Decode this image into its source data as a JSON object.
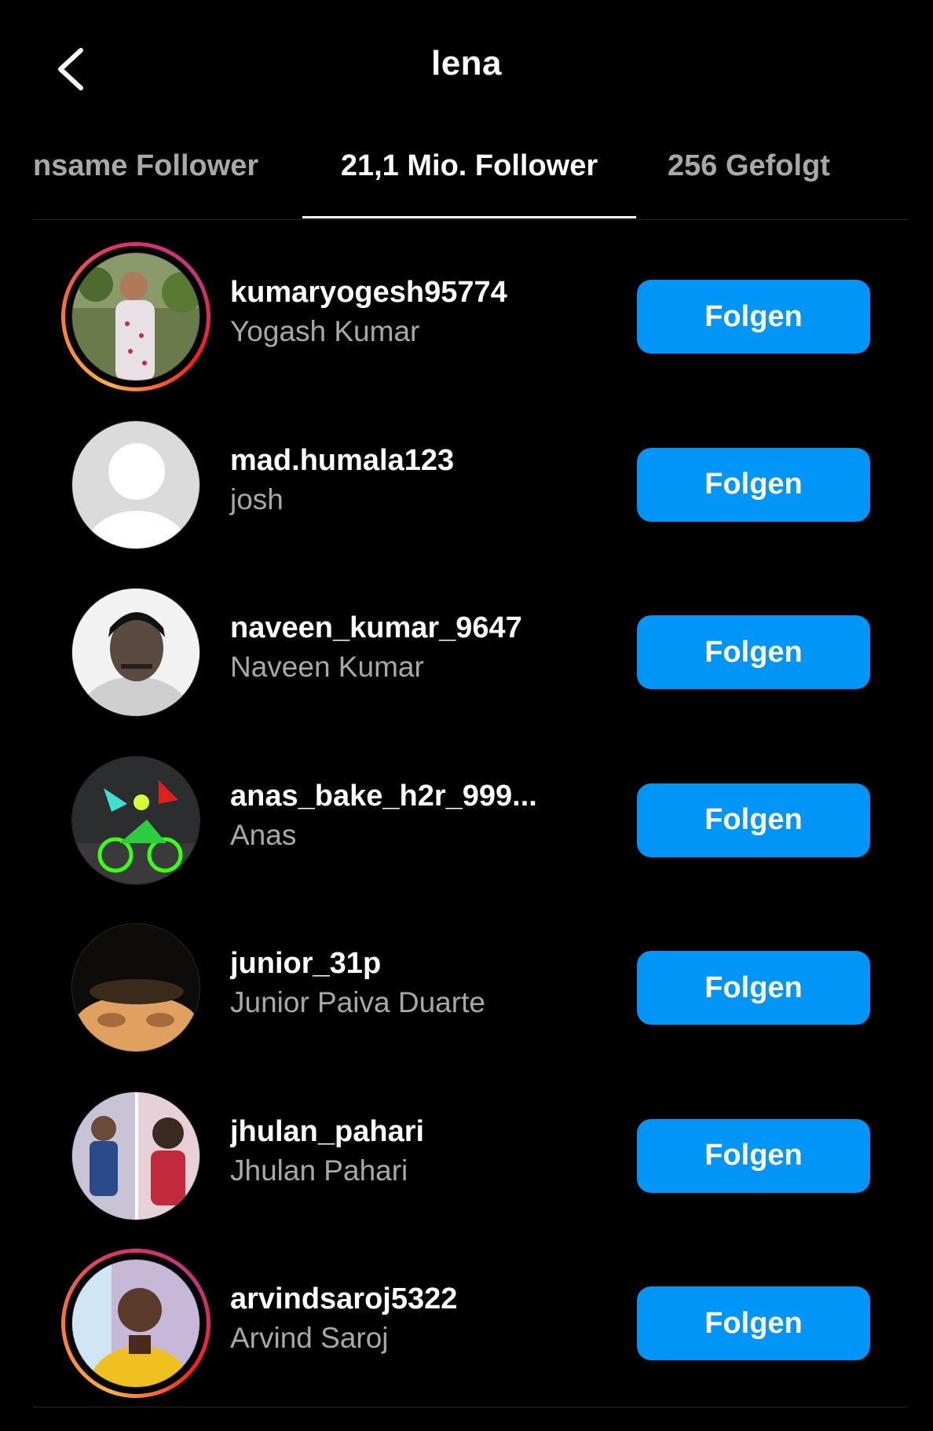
{
  "header": {
    "title": "lena",
    "back_icon": "chevron-left-icon"
  },
  "tabs": [
    {
      "label": "nsame Follower",
      "active": false
    },
    {
      "label": "21,1 Mio. Follower",
      "active": true
    },
    {
      "label": "256 Gefolgt",
      "active": false
    }
  ],
  "colors": {
    "background": "#000000",
    "follow_button": "#0095f6",
    "secondary_text": "#a8a8a8",
    "story_ring": [
      "#fcaf45",
      "#e1306c",
      "#c13584"
    ]
  },
  "followers": [
    {
      "username": "kumaryogesh95774",
      "full_name": "Yogash Kumar",
      "button": "Folgen",
      "story_ring": true
    },
    {
      "username": "mad.humala123",
      "full_name": "josh",
      "button": "Folgen",
      "story_ring": false,
      "default_avatar": true
    },
    {
      "username": "naveen_kumar_9647",
      "full_name": "Naveen Kumar",
      "button": "Folgen",
      "story_ring": false
    },
    {
      "username": "anas_bake_h2r_999...",
      "full_name": "Anas",
      "button": "Folgen",
      "story_ring": false
    },
    {
      "username": "junior_31p",
      "full_name": "Junior Paiva Duarte",
      "button": "Folgen",
      "story_ring": false
    },
    {
      "username": "jhulan_pahari",
      "full_name": "Jhulan Pahari",
      "button": "Folgen",
      "story_ring": false
    },
    {
      "username": "arvindsaroj5322",
      "full_name": "Arvind Saroj",
      "button": "Folgen",
      "story_ring": true
    }
  ]
}
